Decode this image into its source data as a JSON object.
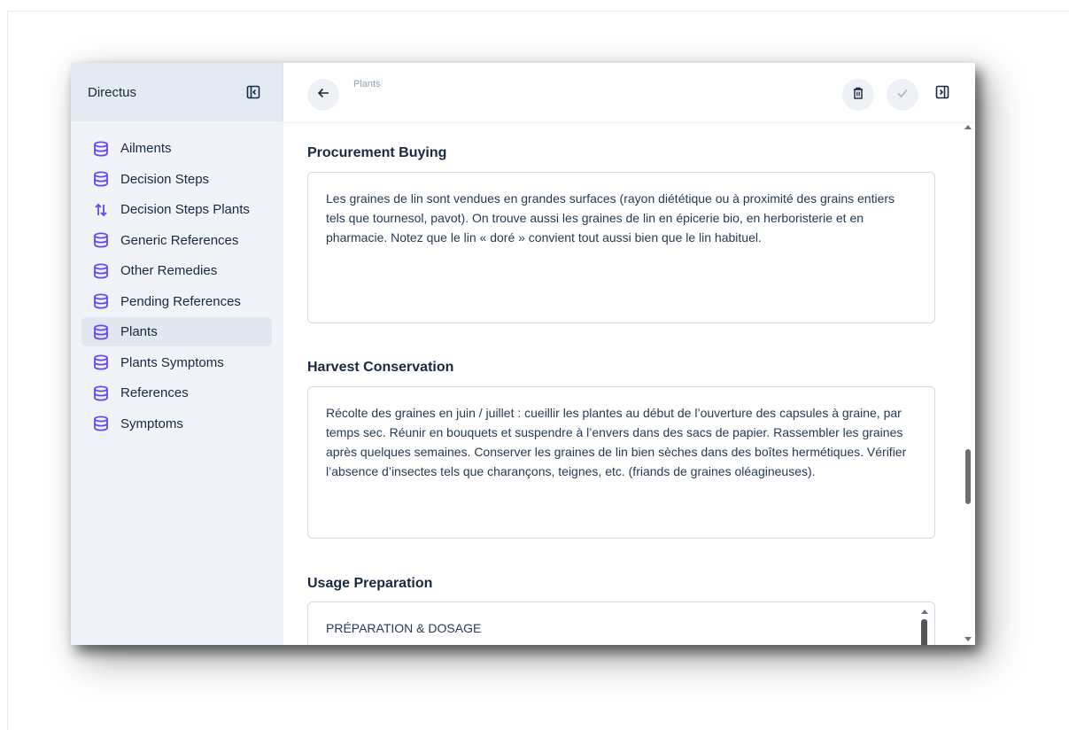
{
  "sidebar": {
    "brand": "Directus",
    "items": [
      {
        "label": "Ailments",
        "icon": "database-icon"
      },
      {
        "label": "Decision Steps",
        "icon": "database-icon"
      },
      {
        "label": "Decision Steps Plants",
        "icon": "import-export-icon"
      },
      {
        "label": "Generic References",
        "icon": "database-icon"
      },
      {
        "label": "Other Remedies",
        "icon": "database-icon"
      },
      {
        "label": "Pending References",
        "icon": "database-icon"
      },
      {
        "label": "Plants",
        "icon": "database-icon",
        "active": true
      },
      {
        "label": "Plants Symptoms",
        "icon": "database-icon"
      },
      {
        "label": "References",
        "icon": "database-icon"
      },
      {
        "label": "Symptoms",
        "icon": "database-icon"
      }
    ]
  },
  "header": {
    "breadcrumb": "Plants"
  },
  "fields": {
    "procurement": {
      "label": "Procurement Buying",
      "value": "Les graines de lin sont vendues en grandes surfaces (rayon diététique ou à proximité des grains entiers tels que tournesol, pavot). On trouve aussi les graines de lin en épicerie bio, en herboristerie et en pharmacie. Notez que le lin « doré » convient tout aussi bien que le lin habituel."
    },
    "harvest": {
      "label": "Harvest Conservation",
      "value": "Récolte des graines en juin / juillet : cueillir les plantes au début de l’ouverture des capsules à graine, par temps sec. Réunir en bouquets et suspendre à l’envers dans des sacs de papier. Rassembler les graines après quelques semaines. Conserver les graines de lin bien sèches dans des boîtes hermétiques. Vérifier l’absence d’insectes tels que charançons, teignes, etc. (friands de graines oléagineuses)."
    },
    "usage": {
      "label": "Usage Preparation",
      "value": "PRÉPARATION & DOSAGE"
    }
  },
  "colors": {
    "accent": "#6644ff",
    "sidebar_bg": "#f0f4f9",
    "sidebar_header_bg": "#e4eaf1",
    "text": "#172940"
  }
}
